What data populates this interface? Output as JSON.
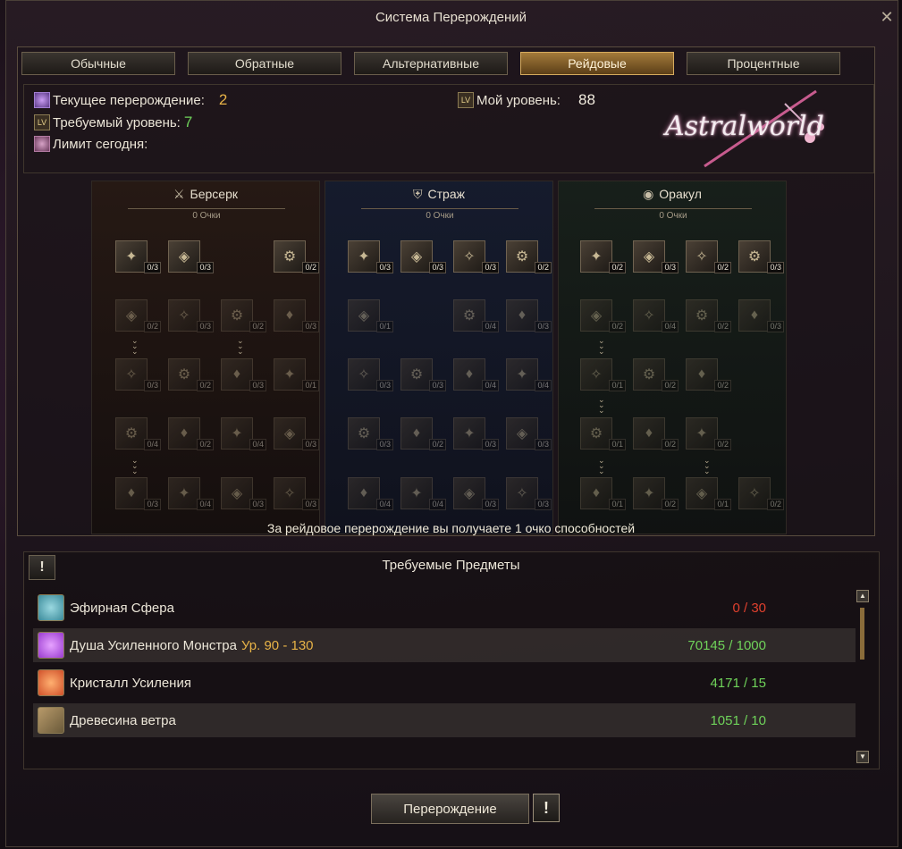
{
  "window": {
    "title": "Система Перерождений"
  },
  "tabs": [
    {
      "label": "Обычные",
      "active": false
    },
    {
      "label": "Обратные",
      "active": false
    },
    {
      "label": "Альтернативные",
      "active": false
    },
    {
      "label": "Рейдовые",
      "active": true
    },
    {
      "label": "Процентные",
      "active": false
    }
  ],
  "info": {
    "current_label": "Текущее перерождение:",
    "current_value": "2",
    "required_label": "Требуемый уровень:",
    "required_value": "7",
    "limit_label": "Лимит сегодня:",
    "my_level_label": "Мой уровень:",
    "my_level_value": "88",
    "lv_icon_text": "LV"
  },
  "logo": {
    "text": "Astralworld"
  },
  "trees": [
    {
      "name": "Берсерк",
      "points": "0 Очки"
    },
    {
      "name": "Страж",
      "points": "0 Очки"
    },
    {
      "name": "Оракул",
      "points": "0 Очки"
    }
  ],
  "skills": [
    [
      [
        "0/3",
        "0/3",
        null,
        "0/2"
      ],
      [
        "0/2",
        "0/3",
        "0/2",
        "0/3"
      ],
      [
        "0/3",
        "0/2",
        "0/3",
        "0/1"
      ],
      [
        "0/4",
        "0/2",
        "0/4",
        "0/3"
      ],
      [
        "0/3",
        "0/4",
        "0/3",
        "0/3"
      ]
    ],
    [
      [
        "0/3",
        "0/3",
        "0/3",
        "0/2"
      ],
      [
        "0/1",
        null,
        "0/4",
        "0/3"
      ],
      [
        "0/3",
        "0/3",
        "0/4",
        "0/4"
      ],
      [
        "0/3",
        "0/2",
        "0/3",
        "0/3"
      ],
      [
        "0/4",
        "0/4",
        "0/3",
        "0/3"
      ]
    ],
    [
      [
        "0/2",
        "0/3",
        "0/2",
        "0/3"
      ],
      [
        "0/2",
        "0/4",
        "0/2",
        "0/3"
      ],
      [
        "0/1",
        "0/2",
        "0/2",
        null
      ],
      [
        "0/1",
        "0/2",
        "0/2",
        null
      ],
      [
        "0/1",
        "0/2",
        "0/1",
        "0/2"
      ]
    ]
  ],
  "raid_note": "За рейдовое перерождение вы получаете 1 очко способностей",
  "required": {
    "title": "Требуемые Предметы",
    "items": [
      {
        "name": "Эфирная Сфера",
        "level": "",
        "qty": "0 / 30",
        "status": "red",
        "icon_color": "#3a8a9a"
      },
      {
        "name": "Душа Усиленного Монстра",
        "level": "Ур. 90 - 130",
        "qty": "70145 / 1000",
        "status": "green",
        "icon_color": "#9a3ad0"
      },
      {
        "name": "Кристалл Усиления",
        "level": "",
        "qty": "4171 / 15",
        "status": "green",
        "icon_color": "#d0502a"
      },
      {
        "name": "Древесина ветра",
        "level": "",
        "qty": "1051 / 10",
        "status": "green",
        "icon_color": "#6a5a3a"
      }
    ]
  },
  "buttons": {
    "rebirth": "Перерождение",
    "warn": "!"
  },
  "colors": {
    "accent_gold": "#e8b347",
    "ok_green": "#6fd35a",
    "error_red": "#e0402e"
  }
}
